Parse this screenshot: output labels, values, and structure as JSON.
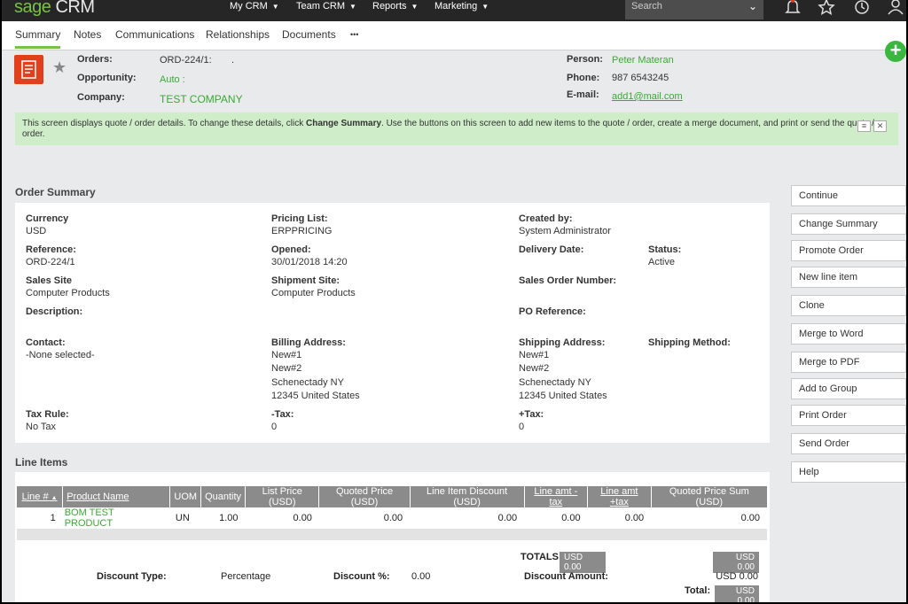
{
  "topnav": {
    "logo_brand": "sage",
    "logo_product": "CRM",
    "items": [
      "My CRM",
      "Team CRM",
      "Reports",
      "Marketing"
    ],
    "search_placeholder": "Search"
  },
  "tabs": [
    "Summary",
    "Notes",
    "Communications",
    "Relationships",
    "Documents",
    "•••"
  ],
  "header": {
    "orders_label": "Orders:",
    "orders_value": "ORD-224/1:",
    "orders_extra": ".",
    "opportunity_label": "Opportunity:",
    "opportunity_value": "Auto :",
    "company_label": "Company:",
    "company_value": "TEST COMPANY",
    "person_label": "Person:",
    "person_value": "Peter Materan",
    "phone_label": "Phone:",
    "phone_value": "987 6543245",
    "email_label": "E-mail:",
    "email_value": "add1@mail.com"
  },
  "info": {
    "text_1": "This screen displays quote / order details. To change these details, click ",
    "text_bold": "Change Summary",
    "text_2": ". Use the buttons on this screen to add new items to the quote / order, create a merge document, and print or send the quote / order."
  },
  "order_summary": {
    "title": "Order Summary",
    "currency_label": "Currency",
    "currency_value": "USD",
    "pricing_label": "Pricing List:",
    "pricing_value": "ERPPRICING",
    "created_label": "Created by:",
    "created_value": "System Administrator",
    "reference_label": "Reference:",
    "reference_value": "ORD-224/1",
    "opened_label": "Opened:",
    "opened_value": "30/01/2018 14:20",
    "delivery_label": "Delivery Date:",
    "status_label": "Status:",
    "status_value": "Active",
    "salessite_label": "Sales Site",
    "salessite_value": "Computer Products",
    "shipsite_label": "Shipment Site:",
    "shipsite_value": "Computer Products",
    "salesorder_label": "Sales Order Number:",
    "description_label": "Description:",
    "po_label": "PO Reference:",
    "contact_label": "Contact:",
    "contact_value": "-None selected-",
    "billing_label": "Billing Address:",
    "billing_lines": [
      "New#1",
      "New#2",
      "Schenectady NY",
      "12345 United States"
    ],
    "shipping_label": "Shipping Address:",
    "shipping_lines": [
      "New#1",
      "New#2",
      "Schenectady NY",
      "12345 United States"
    ],
    "shipmethod_label": "Shipping Method:",
    "taxrule_label": "Tax Rule:",
    "taxrule_value": "No Tax",
    "mtax_label": "-Tax:",
    "mtax_value": "0",
    "ptax_label": "+Tax:",
    "ptax_value": "0"
  },
  "actions": [
    "Continue",
    "Change Summary",
    "Promote Order",
    "New line item",
    "Clone",
    "Merge to Word",
    "Merge to PDF",
    "Add to Group",
    "Print Order",
    "Send Order",
    "Help"
  ],
  "line_items": {
    "title": "Line Items",
    "columns": [
      "Line #",
      "Product Name",
      "UOM",
      "Quantity",
      "List Price (USD)",
      "Quoted Price (USD)",
      "Line Item Discount (USD)",
      "Line amt -tax",
      "Line amt +tax",
      "Quoted Price Sum (USD)"
    ],
    "sort_indicator": "▲",
    "rows": [
      {
        "line": "1",
        "product": "BOM TEST PRODUCT",
        "uom": "UN",
        "qty": "1.00",
        "list": "0.00",
        "quoted": "0.00",
        "discount": "0.00",
        "amt_ex": "0.00",
        "amt_inc": "0.00",
        "sum": "0.00"
      }
    ]
  },
  "totals": {
    "totals_label": "TOTALS",
    "totals_value": "USD 0.00",
    "right_value": "USD 0.00",
    "discount_type_label": "Discount Type:",
    "discount_type_value": "Percentage",
    "discount_pct_label": "Discount %:",
    "discount_pct_value": "0.00",
    "discount_amt_label": "Discount Amount:",
    "discount_amt_value": "USD 0.00",
    "total_label": "Total:",
    "total_value": "USD 0.00"
  }
}
